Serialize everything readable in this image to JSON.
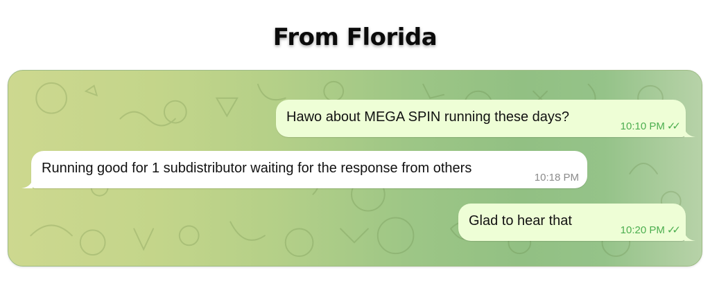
{
  "title": "From Florida",
  "messages": [
    {
      "direction": "outgoing",
      "text": "Hawo about MEGA SPIN running these days?",
      "time": "10:10 PM",
      "status_icon": "double-check-icon"
    },
    {
      "direction": "incoming",
      "text": "Running good for 1 subdistributor waiting for the response from others",
      "time": "10:18 PM"
    },
    {
      "direction": "outgoing",
      "text": "Glad to hear that",
      "time": "10:20 PM",
      "status_icon": "double-check-icon"
    }
  ],
  "colors": {
    "outgoing_bubble": "#eefed6",
    "incoming_bubble": "#ffffff",
    "timestamp_outgoing": "#4cae4f",
    "timestamp_incoming": "#8b8b8b",
    "wallpaper_left": "#cdd88f",
    "wallpaper_right": "#b7d2a8"
  }
}
